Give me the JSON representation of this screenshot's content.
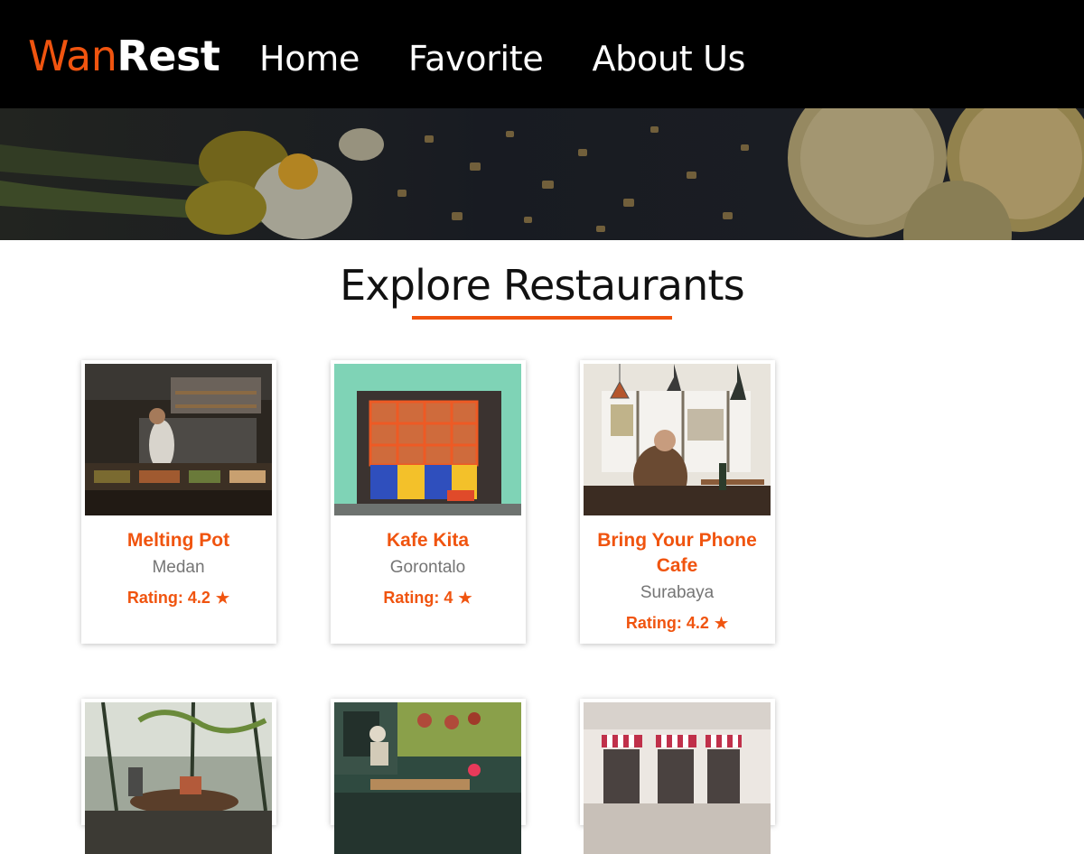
{
  "header": {
    "logo_accent": "Wan",
    "logo_main": "Rest",
    "nav": [
      {
        "label": "Home"
      },
      {
        "label": "Favorite"
      },
      {
        "label": "About Us"
      }
    ]
  },
  "main": {
    "title": "Explore Restaurants"
  },
  "restaurants": [
    {
      "name": "Melting Pot",
      "city": "Medan",
      "rating_label": "Rating:",
      "rating": "4.2",
      "star": "★"
    },
    {
      "name": "Kafe Kita",
      "city": "Gorontalo",
      "rating_label": "Rating:",
      "rating": "4",
      "star": "★"
    },
    {
      "name": "Bring Your Phone Cafe",
      "city": "Surabaya",
      "rating_label": "Rating:",
      "rating": "4.2",
      "star": "★"
    },
    {
      "name": "",
      "city": "",
      "rating_label": "",
      "rating": "",
      "star": ""
    },
    {
      "name": "",
      "city": "",
      "rating_label": "",
      "rating": "",
      "star": ""
    },
    {
      "name": "",
      "city": "",
      "rating_label": "",
      "rating": "",
      "star": ""
    }
  ],
  "colors": {
    "accent": "#f0540f",
    "header_bg": "#000000",
    "text_muted": "#757575"
  }
}
